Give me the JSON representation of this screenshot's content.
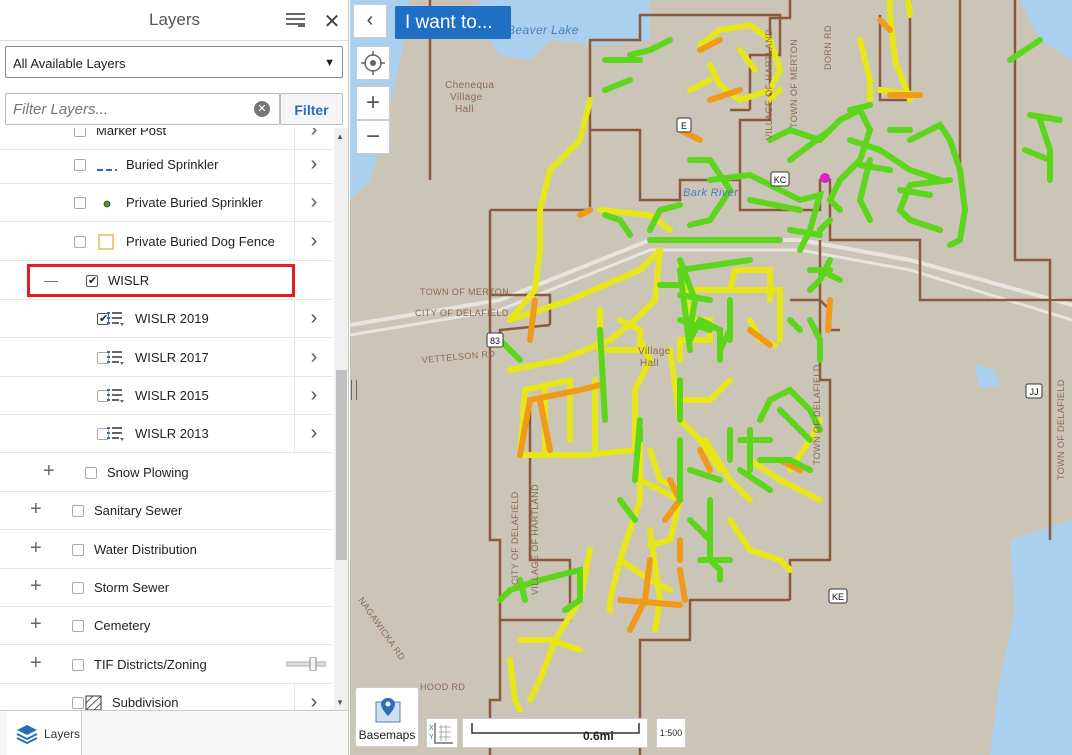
{
  "panel": {
    "title": "Layers",
    "layer_select": "All Available Layers",
    "filter_placeholder": "Filter Layers...",
    "filter_button": "Filter"
  },
  "tree": [
    {
      "label": "Marker Post",
      "indent": 2,
      "checked": false,
      "expander": "",
      "legend": "none"
    },
    {
      "label": "Buried Sprinkler",
      "indent": 2,
      "checked": false,
      "expander": "",
      "legend": "blue-dash"
    },
    {
      "label": "Private Buried Sprinkler",
      "indent": 2,
      "checked": false,
      "expander": "",
      "legend": "green-dot"
    },
    {
      "label": "Private Buried Dog Fence",
      "indent": 2,
      "checked": false,
      "expander": "",
      "legend": "orange-square"
    },
    {
      "label": "WISLR",
      "indent": 1,
      "checked": true,
      "expander": "minus",
      "legend": "none"
    },
    {
      "label": "WISLR 2019",
      "indent": 3,
      "checked": true,
      "expander": "",
      "legend": "list"
    },
    {
      "label": "WISLR 2017",
      "indent": 3,
      "checked": false,
      "expander": "",
      "legend": "list"
    },
    {
      "label": "WISLR 2015",
      "indent": 3,
      "checked": false,
      "expander": "",
      "legend": "list"
    },
    {
      "label": "WISLR 2013",
      "indent": 3,
      "checked": false,
      "expander": "",
      "legend": "list"
    },
    {
      "label": "Snow Plowing",
      "indent": 1,
      "checked": false,
      "expander": "plus",
      "legend": "none"
    },
    {
      "label": "Sanitary Sewer",
      "indent": 0,
      "checked": false,
      "expander": "plus",
      "legend": "none"
    },
    {
      "label": "Water Distribution",
      "indent": 0,
      "checked": false,
      "expander": "plus",
      "legend": "none"
    },
    {
      "label": "Storm Sewer",
      "indent": 0,
      "checked": false,
      "expander": "plus",
      "legend": "none"
    },
    {
      "label": "Cemetery",
      "indent": 0,
      "checked": false,
      "expander": "plus",
      "legend": "none"
    },
    {
      "label": "TIF Districts/Zoning",
      "indent": 0,
      "checked": false,
      "expander": "plus",
      "legend": "slider"
    },
    {
      "label": "Subdivision",
      "indent": 0,
      "checked": false,
      "expander": "",
      "legend": "hatch"
    }
  ],
  "bottom_tab": {
    "label": "Layers"
  },
  "map": {
    "want_button": "I want to...",
    "basemaps_label": "Basemaps",
    "scale_label": "0.6mi",
    "scale_button": "1:500",
    "labels": {
      "beaver_lake": "Beaver Lake",
      "chenequa1": "Chenequa",
      "chenequa2": "Village",
      "chenequa3": "Hall",
      "town_merton": "TOWN OF MERTON",
      "city_delafield": "CITY OF DELAFIELD",
      "vettelson": "VETTELSON RD",
      "hartland_hall1": "Village",
      "hartland_hall2": "Hall",
      "village_hartland_n": "VILLAGE OF HARTLAND",
      "town_merton_v": "TOWN OF MERTON",
      "dorn_rd": "DORN RD",
      "town_delafield_v": "TOWN OF DELAFIELD",
      "town_delafield_v2": "TOWN OF DELAFIELD",
      "city_delafield_v": "CITY OF DELAFIELD",
      "village_hartland_s": "VILLAGE OF HARTLAND",
      "nagawicka": "NAGAWICKA RD",
      "hood_rd": "HOOD RD",
      "hwy_e": "E",
      "hwy_kc": "KC",
      "hwy_ke": "KE",
      "hwy_jj": "JJ",
      "hwy_83": "83",
      "bark_river": "Bark River"
    },
    "colors": {
      "green": "#5cd51b",
      "yellow": "#e6e61a",
      "orange": "#f09a1a",
      "boundary": "#8b5a3c",
      "terrain": "#cbc5b8",
      "water": "#a9d0ee"
    }
  }
}
